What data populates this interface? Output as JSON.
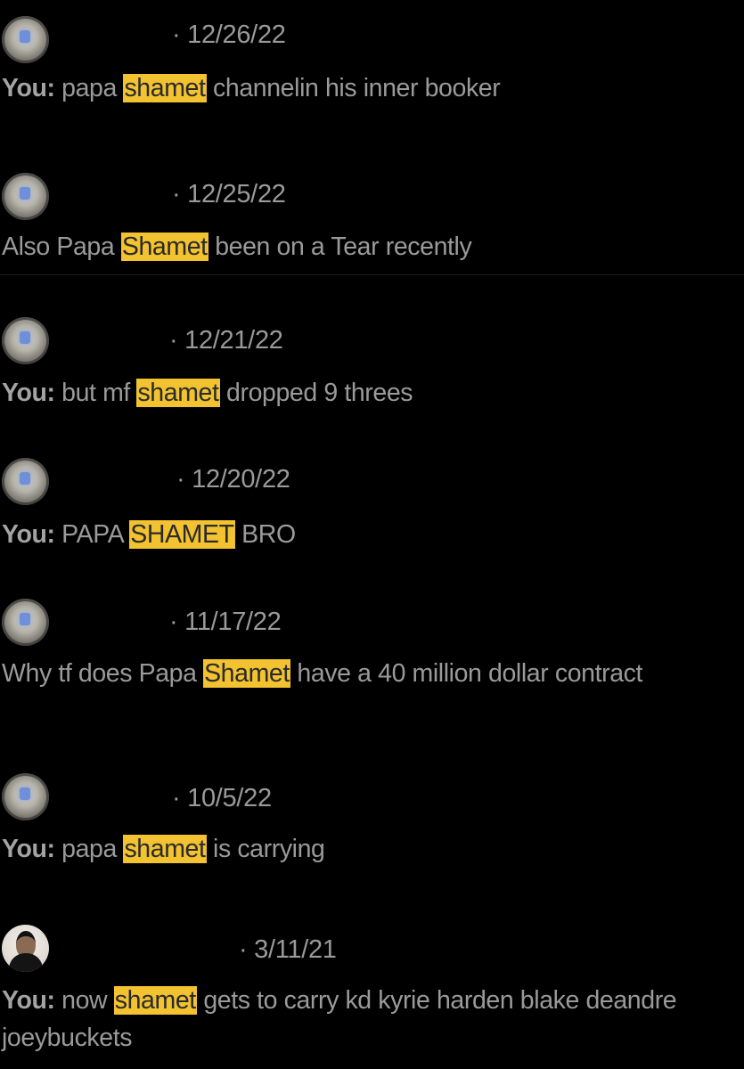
{
  "you_label": "You:",
  "highlight_color": "#f2c230",
  "results": [
    {
      "avatar": "avatar-icon",
      "date": "· 12/26/22",
      "sender": "You:",
      "before": " papa ",
      "match": "shamet",
      "after": " channelin his inner booker"
    },
    {
      "avatar": "avatar-icon",
      "date": "· 12/25/22",
      "sender": "",
      "before": "Also Papa ",
      "match": "Shamet",
      "after": " been on a Tear recently"
    },
    {
      "avatar": "avatar-icon",
      "date": "· 12/21/22",
      "sender": "You:",
      "before": " but mf ",
      "match": "shamet",
      "after": " dropped 9 threes"
    },
    {
      "avatar": "avatar-icon",
      "date": "· 12/20/22",
      "sender": "You:",
      "before": " PAPA ",
      "match": "SHAMET",
      "after": " BRO"
    },
    {
      "avatar": "avatar-icon",
      "date": "· 11/17/22",
      "sender": "",
      "before": "Why tf does Papa ",
      "match": "Shamet",
      "after": " have a 40 million dollar contract"
    },
    {
      "avatar": "avatar-icon",
      "date": "· 10/5/22",
      "sender": "You:",
      "before": " papa ",
      "match": "shamet",
      "after": " is carrying"
    },
    {
      "avatar": "person-avatar-icon",
      "date": "· 3/11/21",
      "sender": "You:",
      "before": " now ",
      "match": "shamet",
      "after": " gets to carry kd kyrie harden blake deandre joeybuckets"
    }
  ]
}
